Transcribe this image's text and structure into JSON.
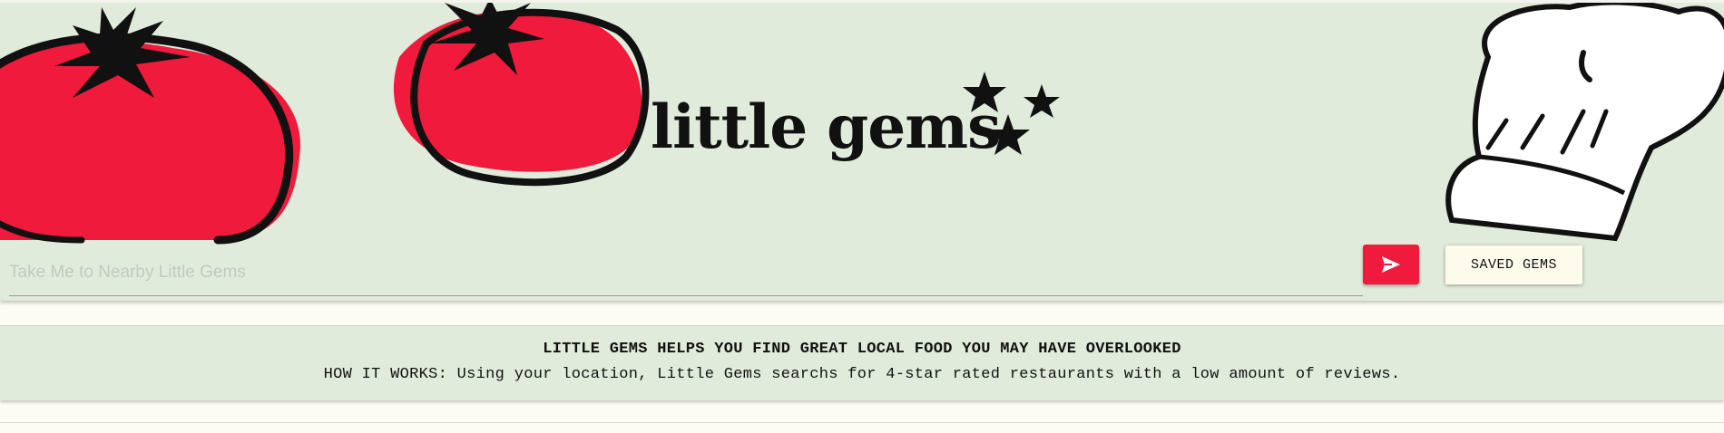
{
  "header": {
    "logo_text": "little gems",
    "search": {
      "placeholder": "Take Me to Nearby Little Gems",
      "value": ""
    },
    "send_button_icon": "send-icon",
    "saved_button_label": "SAVED GEMS"
  },
  "info": {
    "headline": "LITTLE GEMS HELPS YOU FIND GREAT LOCAL FOOD YOU MAY HAVE OVERLOOKED",
    "how_it_works": "HOW IT WORKS: Using your location, Little Gems searchs for 4-star rated restaurants with a low amount of reviews."
  },
  "colors": {
    "header_bg": "#e1ebdb",
    "page_bg": "#fdfcf4",
    "accent_red": "#ef1a3c",
    "button_cream": "#fdfbec"
  },
  "icons": [
    "tomato-icon",
    "star-icon",
    "chef-hat-icon",
    "send-icon"
  ]
}
